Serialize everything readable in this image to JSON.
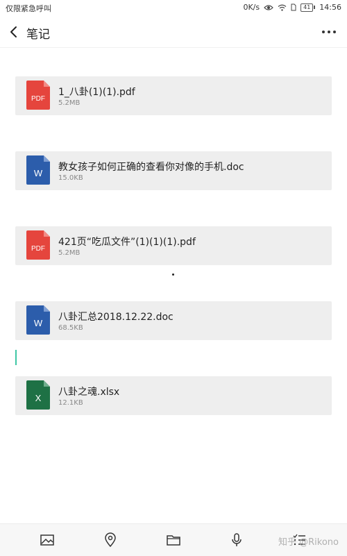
{
  "status_bar": {
    "carrier": "仅限紧急呼叫",
    "speed": "0K/s",
    "battery": "41",
    "time": "14:56"
  },
  "header": {
    "title": "笔记"
  },
  "attachments": [
    {
      "type_label": "PDF",
      "icon": "pdf-file-icon",
      "color": "#e5453d",
      "name": "1_八卦(1)(1).pdf",
      "size": "5.2MB"
    },
    {
      "type_label": "W",
      "icon": "word-file-icon",
      "color": "#2c5dab",
      "name": "教女孩子如何正确的查看你对像的手机.doc",
      "size": "15.0KB"
    },
    {
      "type_label": "PDF",
      "icon": "pdf-file-icon",
      "color": "#e5453d",
      "name": "421页“吃瓜文件”(1)(1)(1).pdf",
      "size": "5.2MB"
    },
    {
      "type_label": "W",
      "icon": "word-file-icon",
      "color": "#2c5dab",
      "name": "八卦汇总2018.12.22.doc",
      "size": "68.5KB"
    },
    {
      "type_label": "X",
      "icon": "excel-file-icon",
      "color": "#1e7145",
      "name": "八卦之魂.xlsx",
      "size": "12.1KB"
    }
  ],
  "toolbar": {
    "icons": [
      "image-icon",
      "location-icon",
      "folder-icon",
      "microphone-icon",
      "checklist-icon"
    ]
  },
  "watermark": "知乎 @Rikono"
}
